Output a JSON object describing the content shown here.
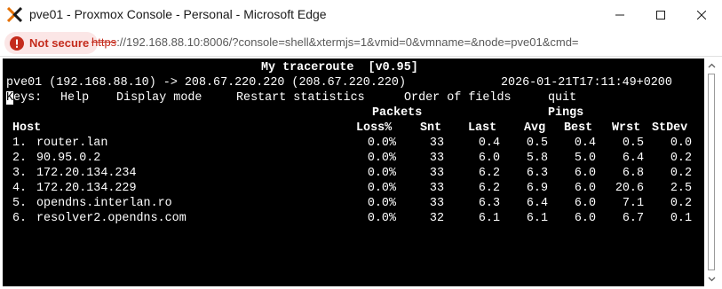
{
  "window": {
    "title": "pve01 - Proxmox Console - Personal - Microsoft Edge",
    "icon": "proxmox-x-icon",
    "controls": [
      "minimize-icon",
      "maximize-icon",
      "close-icon"
    ]
  },
  "address_bar": {
    "security_label": "Not secure",
    "security_color": "#c42b1c",
    "url_scheme": "https",
    "url_rest": "://192.168.88.10:8006/?console=shell&xtermjs=1&vmid=0&vmname=&node=pve01&cmd="
  },
  "terminal": {
    "program_title": "My traceroute  [v0.95]",
    "route_line": "pve01 (192.168.88.10) -> 208.67.220.220 (208.67.220.220)",
    "timestamp": "2026-01-21T17:11:49+0200",
    "keys_cursor_char": "K",
    "keys_rest": "eys:",
    "menu": [
      "Help",
      "Display mode",
      "Restart statistics",
      "Order of fields",
      "quit"
    ],
    "group_headers": {
      "packets": "Packets",
      "pings": "Pings"
    },
    "columns": [
      "Host",
      "Loss%",
      "Snt",
      "Last",
      "Avg",
      "Best",
      "Wrst",
      "StDev"
    ],
    "rows": [
      {
        "num": "1.",
        "host": "router.lan",
        "loss": "0.0%",
        "snt": "33",
        "last": "0.4",
        "avg": "0.5",
        "best": "0.4",
        "wrst": "0.5",
        "stdev": "0.0"
      },
      {
        "num": "2.",
        "host": "90.95.0.2",
        "loss": "0.0%",
        "snt": "33",
        "last": "6.0",
        "avg": "5.8",
        "best": "5.0",
        "wrst": "6.4",
        "stdev": "0.2"
      },
      {
        "num": "3.",
        "host": "172.20.134.234",
        "loss": "0.0%",
        "snt": "33",
        "last": "6.2",
        "avg": "6.3",
        "best": "6.0",
        "wrst": "6.8",
        "stdev": "0.2"
      },
      {
        "num": "4.",
        "host": "172.20.134.229",
        "loss": "0.0%",
        "snt": "33",
        "last": "6.2",
        "avg": "6.9",
        "best": "6.0",
        "wrst": "20.6",
        "stdev": "2.5"
      },
      {
        "num": "5.",
        "host": "opendns.interlan.ro",
        "loss": "0.0%",
        "snt": "33",
        "last": "6.3",
        "avg": "6.4",
        "best": "6.0",
        "wrst": "7.1",
        "stdev": "0.2"
      },
      {
        "num": "6.",
        "host": "resolver2.opendns.com",
        "loss": "0.0%",
        "snt": "32",
        "last": "6.1",
        "avg": "6.1",
        "best": "6.0",
        "wrst": "6.7",
        "stdev": "0.1"
      }
    ]
  },
  "scrollbar": {
    "up": "scroll-up-arrow-icon",
    "down": "scroll-down-arrow-icon"
  }
}
